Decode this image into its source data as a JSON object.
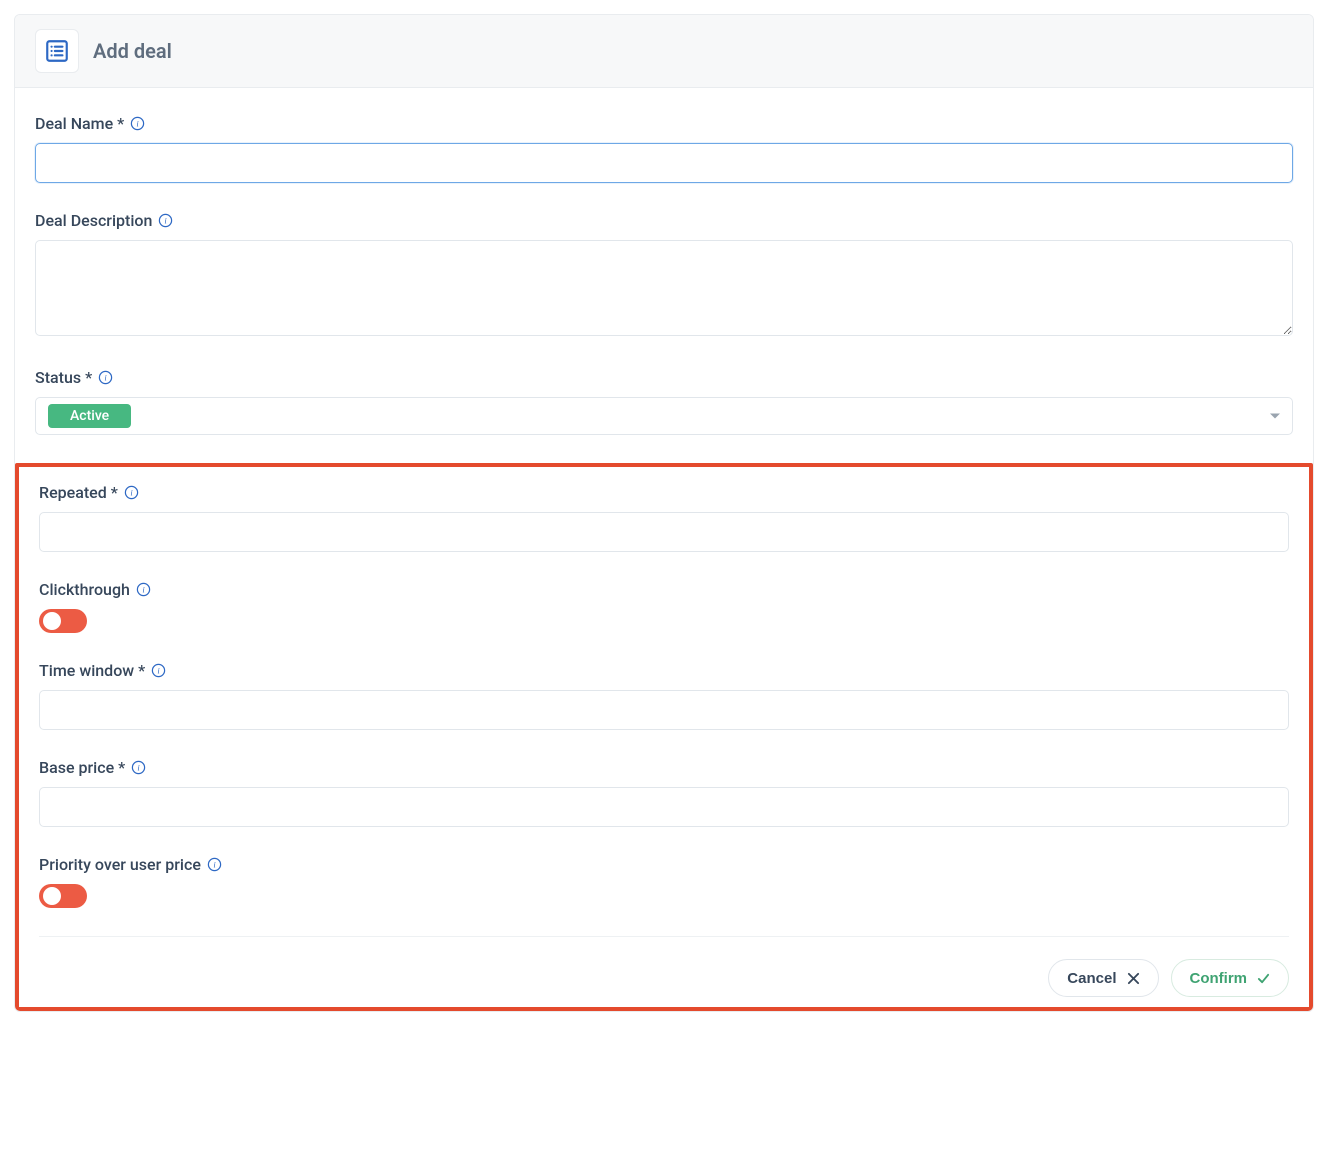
{
  "header": {
    "title": "Add deal"
  },
  "fields": {
    "deal_name": {
      "label": "Deal Name *",
      "value": ""
    },
    "deal_description": {
      "label": "Deal Description",
      "value": ""
    },
    "status": {
      "label": "Status *",
      "selected": "Active"
    },
    "repeated": {
      "label": "Repeated *",
      "value": ""
    },
    "clickthrough": {
      "label": "Clickthrough",
      "value": true
    },
    "time_window": {
      "label": "Time window *",
      "value": ""
    },
    "base_price": {
      "label": "Base price *",
      "value": ""
    },
    "priority_over_user_price": {
      "label": "Priority over user price",
      "value": true
    }
  },
  "actions": {
    "cancel": "Cancel",
    "confirm": "Confirm"
  }
}
